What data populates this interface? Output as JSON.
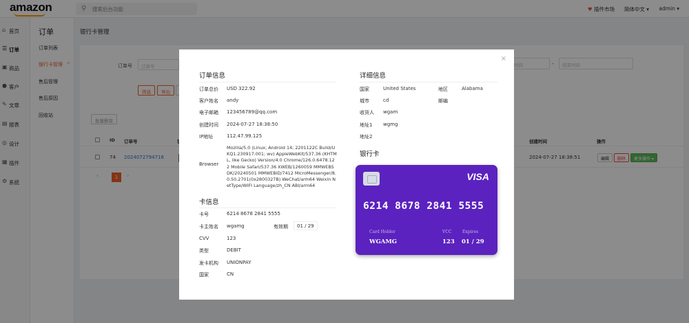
{
  "app": {
    "logo": "amazon",
    "search_placeholder": "搜索后台功能",
    "top_right": {
      "plugin_market": "插件市场",
      "language": "简体中文",
      "user": "admin"
    }
  },
  "left_nav": [
    {
      "label": "首页",
      "icon": "home-icon",
      "glyph": "⌂"
    },
    {
      "label": "订单",
      "icon": "order-icon",
      "glyph": "☰",
      "active": true
    },
    {
      "label": "商品",
      "icon": "goods-icon",
      "glyph": "▣"
    },
    {
      "label": "客户",
      "icon": "user-icon",
      "glyph": "●"
    },
    {
      "label": "文章",
      "icon": "article-icon",
      "glyph": "✎"
    },
    {
      "label": "报表",
      "icon": "report-icon",
      "glyph": "▤"
    },
    {
      "label": "设计",
      "icon": "design-icon",
      "glyph": "◎"
    },
    {
      "label": "插件",
      "icon": "plugin-icon",
      "glyph": "▦"
    },
    {
      "label": "系统",
      "icon": "settings-icon",
      "glyph": "⚙"
    }
  ],
  "sub_nav": {
    "title": "订单",
    "items": [
      {
        "label": "订单列表"
      },
      {
        "label": "银行卡管理",
        "active": true,
        "caret": "^"
      },
      {
        "label": "售后管理"
      },
      {
        "label": "售后原因"
      },
      {
        "label": "回收站"
      }
    ]
  },
  "page": {
    "title": "银行卡管理",
    "filter_label": "订单号",
    "filter_placeholder": "订单号",
    "date_start_placeholder": "开始时间",
    "date_end_placeholder": "结束时间",
    "date_dash": "-",
    "buttons": {
      "filter": "筛选",
      "export": "导出",
      "third": "重"
    },
    "bulk_delete": "批量删除",
    "table": {
      "headers": {
        "id": "ID",
        "order_no": "订单号",
        "status": "状",
        "created": "创建时间",
        "actions": "操作"
      },
      "rows": [
        {
          "id": "74",
          "order_no": "2024072794716",
          "created": "2024-07-27 18:38:51",
          "edit": "编辑",
          "delete": "删除",
          "more": "更多操作 ▾"
        }
      ]
    },
    "pager": {
      "prev": "‹",
      "current": "1",
      "next": "›"
    }
  },
  "modal": {
    "close": "×",
    "order_info": {
      "title": "订单信息",
      "fields": [
        {
          "k": "订单总价",
          "v": "USD 322.92"
        },
        {
          "k": "客户姓名",
          "v": "andy"
        },
        {
          "k": "电子邮箱",
          "v": "123456789@qq.com"
        },
        {
          "k": "创建时间",
          "v": "2024-07-27 18:38:50"
        },
        {
          "k": "IP地址",
          "v": "112.47.99.125"
        },
        {
          "k": "Browser",
          "v": "Mozilla/5.0 (Linux; Android 14; 2201122C Build/UKQ1.230917.001; wv) AppleWebKit/537.36 (KHTML, like Gecko) Version/4.0 Chrome/126.0.6478.122 Mobile Safari/537.36 XWEB/1260059 MMWEBSDK/20240501 MMWEBID/7412 MicroMessenger/8.0.50.2701(0x2800327B) WeChat/arm64 Weixin NetType/WIFI Language/zh_CN ABI/arm64"
        }
      ]
    },
    "card_info": {
      "title": "卡信息",
      "card_no_k": "卡号",
      "card_no_v": "6214 8678 2841 5555",
      "holder_k": "卡主姓名",
      "holder_v": "wgamg",
      "expiry_k": "有效期",
      "expiry_v": "01 / 29",
      "cvv_k": "CVV",
      "cvv_v": "123",
      "type_k": "类型",
      "type_v": "DEBIT",
      "issuer_k": "发卡机构",
      "issuer_v": "UNIONPAY",
      "country_k": "国家",
      "country_v": "CN"
    },
    "detail_info": {
      "title": "详细信息",
      "country_k": "国家",
      "country_v": "United States",
      "region_k": "地区",
      "region_v": "Alabama",
      "city_k": "城市",
      "city_v": "cd",
      "zip_k": "邮编",
      "zip_v": "",
      "receiver_k": "收货人",
      "receiver_v": "wgam",
      "addr1_k": "地址1",
      "addr1_v": "wgmg",
      "addr2_k": "地址2",
      "addr2_v": ""
    },
    "bank_card": {
      "title": "银行卡",
      "brand": "VISA",
      "number": "6214 8678 2841 5555",
      "holder_label": "Card Holder",
      "holder": "WGAMG",
      "vcc_label": "VCC",
      "vcc": "123",
      "expires_label": "Expires",
      "expires": "01 / 29",
      "color": "#5b22bf"
    }
  }
}
